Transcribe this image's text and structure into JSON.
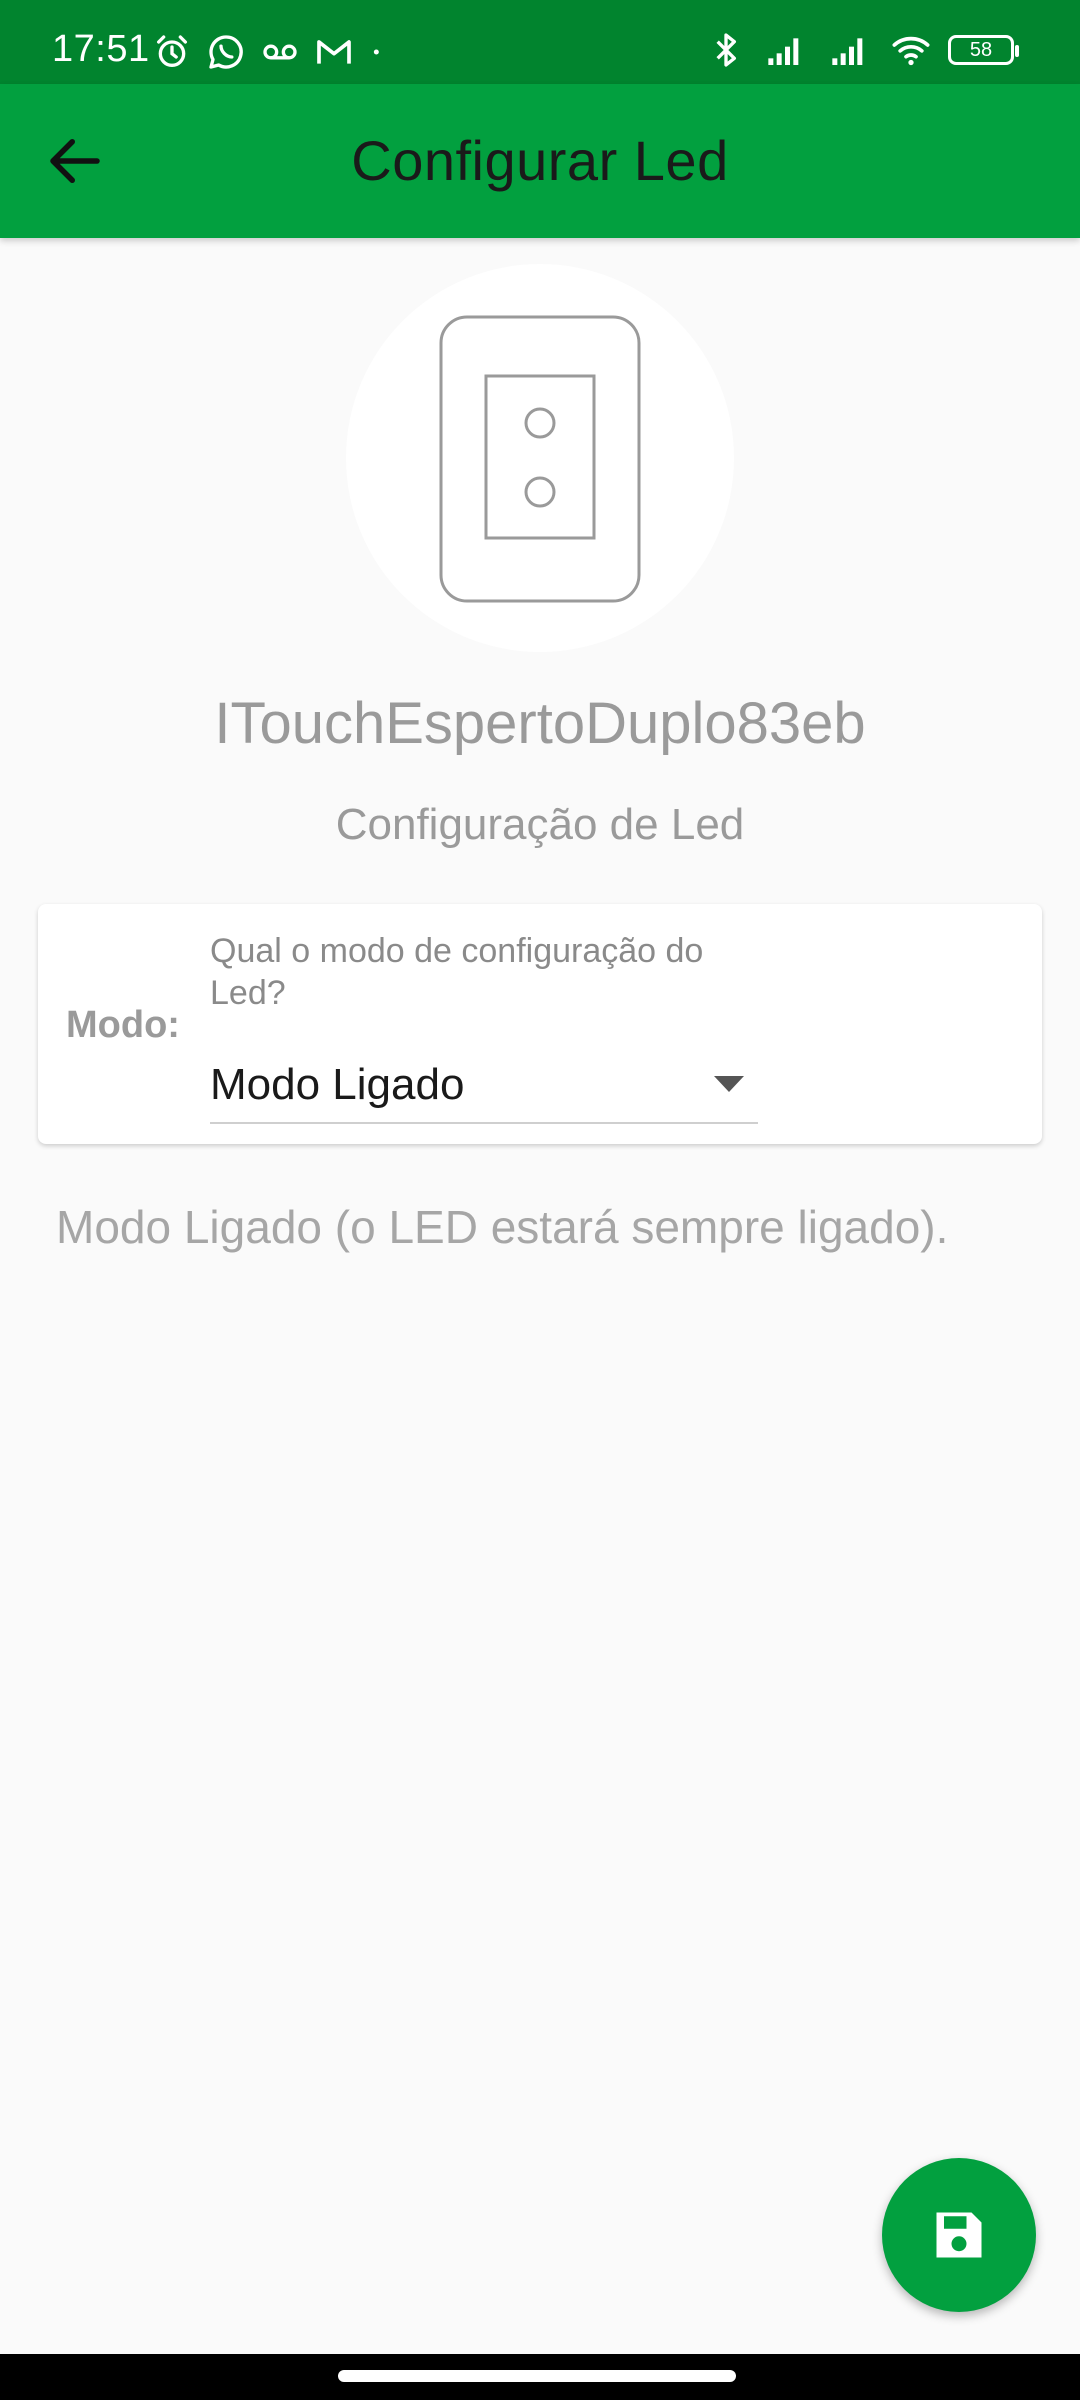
{
  "status_bar": {
    "time": "17:51",
    "battery": "58",
    "icons_left": [
      "alarm-icon",
      "whatsapp-icon",
      "voicemail-icon",
      "gmail-icon",
      "dot-icon"
    ],
    "icons_right": [
      "bluetooth-icon",
      "signal-icon",
      "signal-icon",
      "wifi-icon",
      "battery-icon"
    ]
  },
  "app_bar": {
    "title": "Configurar Led",
    "back_icon": "arrow-left-icon",
    "color": "#02a03f"
  },
  "device": {
    "icon": "double-switch-icon",
    "name": "ITouchEspertoDuplo83eb"
  },
  "section": {
    "title": "Configuração de Led"
  },
  "mode_card": {
    "label": "Modo:",
    "question": "Qual o modo de configuração do Led?",
    "selected": "Modo Ligado"
  },
  "description": "Modo Ligado (o LED estará sempre ligado).",
  "fab": {
    "icon": "save-icon",
    "color": "#02a03f"
  }
}
